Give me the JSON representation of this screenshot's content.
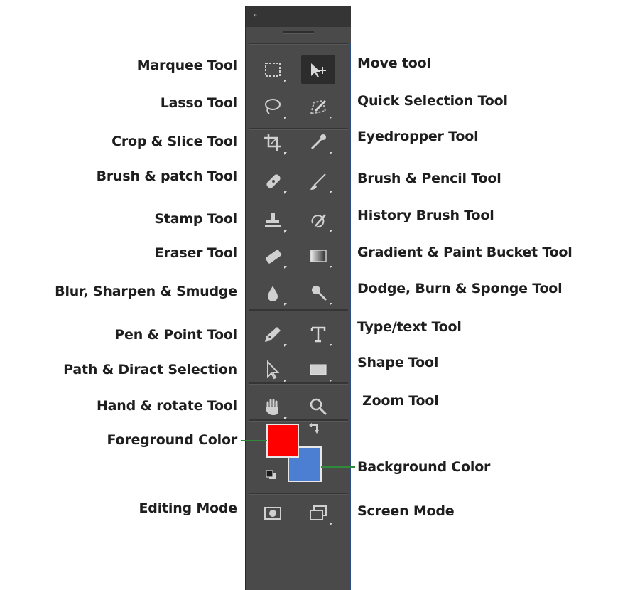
{
  "left_labels": [
    {
      "id": "marquee",
      "text": "Marquee Tool"
    },
    {
      "id": "lasso",
      "text": "Lasso Tool"
    },
    {
      "id": "crop",
      "text": "Crop & Slice Tool"
    },
    {
      "id": "brush-patch",
      "text": "Brush & patch Tool"
    },
    {
      "id": "stamp",
      "text": "Stamp Tool"
    },
    {
      "id": "eraser",
      "text": "Eraser Tool"
    },
    {
      "id": "blur",
      "text": "Blur, Sharpen & Smudge"
    },
    {
      "id": "pen",
      "text": "Pen & Point Tool"
    },
    {
      "id": "path",
      "text": "Path & Diract Selection"
    },
    {
      "id": "hand",
      "text": "Hand & rotate Tool"
    },
    {
      "id": "foreground",
      "text": "Foreground Color"
    },
    {
      "id": "editing-mode",
      "text": "Editing Mode"
    }
  ],
  "right_labels": [
    {
      "id": "move",
      "text": "Move tool"
    },
    {
      "id": "quick-selection",
      "text": "Quick Selection Tool"
    },
    {
      "id": "eyedropper",
      "text": "Eyedropper Tool"
    },
    {
      "id": "brush-pencil",
      "text": "Brush & Pencil Tool"
    },
    {
      "id": "history-brush",
      "text": "History Brush Tool"
    },
    {
      "id": "gradient",
      "text": "Gradient & Paint Bucket Tool"
    },
    {
      "id": "dodge",
      "text": "Dodge, Burn & Sponge Tool"
    },
    {
      "id": "type",
      "text": "Type/text Tool"
    },
    {
      "id": "shape",
      "text": "Shape Tool"
    },
    {
      "id": "zoom",
      "text": "Zoom Tool"
    },
    {
      "id": "background",
      "text": "Background Color"
    },
    {
      "id": "screen-mode",
      "text": "Screen Mode"
    }
  ],
  "colors": {
    "foreground": "#ff0000",
    "background": "#4c7fd1",
    "toolbar": "#4a4a4a",
    "leader_line": "#2e8b3a"
  },
  "icons": {
    "panel_collapse": "»"
  }
}
